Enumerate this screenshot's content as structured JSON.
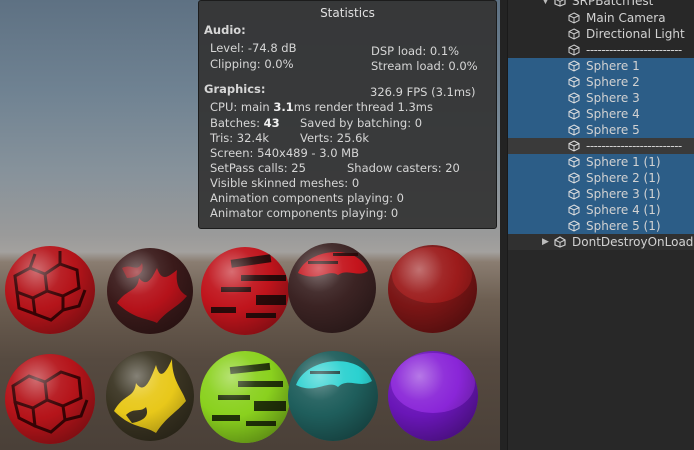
{
  "statistics": {
    "title": "Statistics",
    "audio": {
      "header": "Audio:",
      "level": "Level: -74.8 dB",
      "dsp_load": "DSP load: 0.1%",
      "clipping": "Clipping: 0.0%",
      "stream_load": "Stream load: 0.0%"
    },
    "graphics": {
      "header": "Graphics:",
      "fps": "326.9 FPS (3.1ms)",
      "cpu_prefix": "CPU: main ",
      "cpu_main": "3.1",
      "cpu_suffix": "ms  render thread 1.3ms",
      "batches_prefix": "Batches: ",
      "batches": "43",
      "saved_by_batching": "Saved by batching: 0",
      "tris": "Tris: 32.4k",
      "verts": "Verts: 25.6k",
      "screen": "Screen: 540x489 - 3.0 MB",
      "setpass": "SetPass calls: 25",
      "shadow_casters": "Shadow casters: 20",
      "skinned": "Visible skinned meshes: 0",
      "animation": "Animation components playing: 0",
      "animator": "Animator components playing: 0"
    }
  },
  "hierarchy": {
    "scene_name": "SRPBatchTest",
    "items": [
      {
        "label": "Main Camera",
        "selected": false
      },
      {
        "label": "Directional Light",
        "selected": false
      },
      {
        "label": "-------------------------",
        "selected": false
      },
      {
        "label": "Sphere 1",
        "selected": true
      },
      {
        "label": "Sphere 2",
        "selected": true
      },
      {
        "label": "Sphere 3",
        "selected": true
      },
      {
        "label": "Sphere 4",
        "selected": true
      },
      {
        "label": "Sphere 5",
        "selected": true
      },
      {
        "label": "-------------------------",
        "selected": true
      },
      {
        "label": "Sphere 1 (1)",
        "selected": true
      },
      {
        "label": "Sphere 2 (1)",
        "selected": true
      },
      {
        "label": "Sphere 3 (1)",
        "selected": true
      },
      {
        "label": "Sphere 4 (1)",
        "selected": true
      },
      {
        "label": "Sphere 5 (1)",
        "selected": true
      }
    ],
    "dont_destroy": "DontDestroyOnLoad"
  },
  "colors": {
    "selection": "#2c5d87",
    "panel_bg": "#282828",
    "stats_bg": "#343434"
  },
  "icons": {
    "gameobject": "cube-icon",
    "scene": "unity-scene-icon"
  }
}
